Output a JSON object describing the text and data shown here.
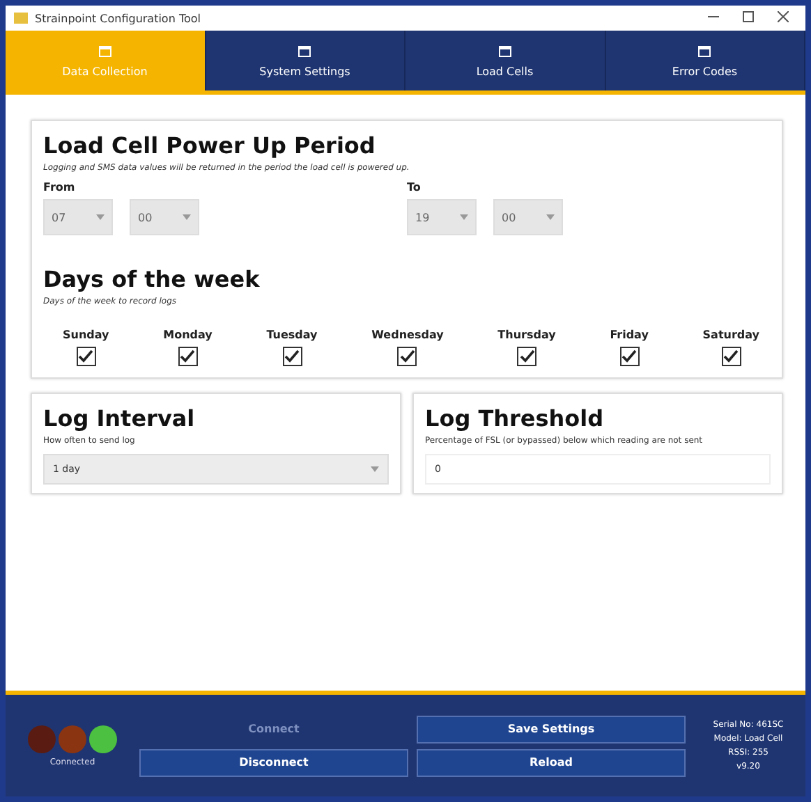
{
  "window": {
    "title": "Strainpoint Configuration Tool"
  },
  "tabs": [
    {
      "label": "Data Collection",
      "selected": true
    },
    {
      "label": "System Settings",
      "selected": false
    },
    {
      "label": "Load Cells",
      "selected": false
    },
    {
      "label": "Error Codes",
      "selected": false
    }
  ],
  "power_up": {
    "title": "Load Cell Power Up Period",
    "description": "Logging and SMS data values will be returned in the period the load cell is powered up.",
    "from": {
      "label": "From",
      "hour": "07",
      "minute": "00"
    },
    "to": {
      "label": "To",
      "hour": "19",
      "minute": "00"
    }
  },
  "days": {
    "title": "Days of the week",
    "description": "Days of the week to record logs",
    "items": [
      {
        "label": "Sunday",
        "checked": true
      },
      {
        "label": "Monday",
        "checked": true
      },
      {
        "label": "Tuesday",
        "checked": true
      },
      {
        "label": "Wednesday",
        "checked": true
      },
      {
        "label": "Thursday",
        "checked": true
      },
      {
        "label": "Friday",
        "checked": true
      },
      {
        "label": "Saturday",
        "checked": true
      }
    ]
  },
  "log_interval": {
    "title": "Log Interval",
    "description": "How often to send log",
    "value": "1 day"
  },
  "log_threshold": {
    "title": "Log Threshold",
    "description": "Percentage of FSL (or bypassed) below which reading are not sent",
    "value": "0"
  },
  "footer": {
    "lights": [
      {
        "color": "#5a1c12"
      },
      {
        "color": "#8a3412"
      },
      {
        "color": "#4cc040"
      }
    ],
    "status": "Connected",
    "buttons": [
      {
        "label": "Connect",
        "disabled": true
      },
      {
        "label": "Save Settings",
        "disabled": false
      },
      {
        "label": "Disconnect",
        "disabled": false
      },
      {
        "label": "Reload",
        "disabled": false
      }
    ],
    "info": [
      "Serial No: 461SC",
      "Model: Load Cell",
      "RSSI: 255",
      "v9.20"
    ]
  }
}
